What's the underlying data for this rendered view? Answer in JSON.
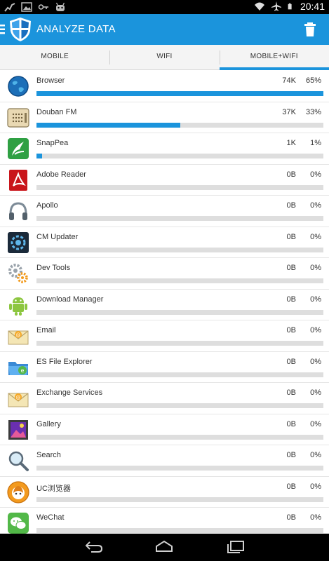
{
  "status_bar": {
    "time": "20:41",
    "left_icons": [
      "activity-icon",
      "image-icon",
      "key-icon",
      "android-icon"
    ],
    "right_icons": [
      "wifi-icon",
      "airplane-icon",
      "battery-icon"
    ]
  },
  "action_bar": {
    "title": "ANALYZE DATA",
    "accent": "#1b94dc"
  },
  "tabs": [
    {
      "label": "MOBILE",
      "active": false
    },
    {
      "label": "WIFI",
      "active": false
    },
    {
      "label": "MOBILE+WIFI",
      "active": true
    }
  ],
  "apps": [
    {
      "name": "Browser",
      "size": "74K",
      "percent": "65%",
      "fraction": 1.0,
      "icon": "globe-icon"
    },
    {
      "name": "Douban FM",
      "size": "37K",
      "percent": "33%",
      "fraction": 0.5,
      "icon": "radio-icon"
    },
    {
      "name": "SnapPea",
      "size": "1K",
      "percent": "1%",
      "fraction": 0.02,
      "icon": "snappea-icon"
    },
    {
      "name": "Adobe Reader",
      "size": "0B",
      "percent": "0%",
      "fraction": 0,
      "icon": "pdf-icon"
    },
    {
      "name": "Apollo",
      "size": "0B",
      "percent": "0%",
      "fraction": 0,
      "icon": "headphones-icon"
    },
    {
      "name": "CM Updater",
      "size": "0B",
      "percent": "0%",
      "fraction": 0,
      "icon": "updater-gear-icon"
    },
    {
      "name": "Dev Tools",
      "size": "0B",
      "percent": "0%",
      "fraction": 0,
      "icon": "gears-icon"
    },
    {
      "name": "Download Manager",
      "size": "0B",
      "percent": "0%",
      "fraction": 0,
      "icon": "android-robot-icon"
    },
    {
      "name": "Email",
      "size": "0B",
      "percent": "0%",
      "fraction": 0,
      "icon": "envelope-icon"
    },
    {
      "name": "ES File Explorer",
      "size": "0B",
      "percent": "0%",
      "fraction": 0,
      "icon": "folder-icon"
    },
    {
      "name": "Exchange Services",
      "size": "0B",
      "percent": "0%",
      "fraction": 0,
      "icon": "envelope-icon"
    },
    {
      "name": "Gallery",
      "size": "0B",
      "percent": "0%",
      "fraction": 0,
      "icon": "picture-icon"
    },
    {
      "name": "Search",
      "size": "0B",
      "percent": "0%",
      "fraction": 0,
      "icon": "magnifier-icon"
    },
    {
      "name": "UC浏览器",
      "size": "0B",
      "percent": "0%",
      "fraction": 0,
      "icon": "uc-squirrel-icon"
    },
    {
      "name": "WeChat",
      "size": "0B",
      "percent": "0%",
      "fraction": 0,
      "icon": "chat-bubbles-icon"
    }
  ],
  "nav_bar": [
    "back-icon",
    "home-icon",
    "recent-apps-icon"
  ]
}
